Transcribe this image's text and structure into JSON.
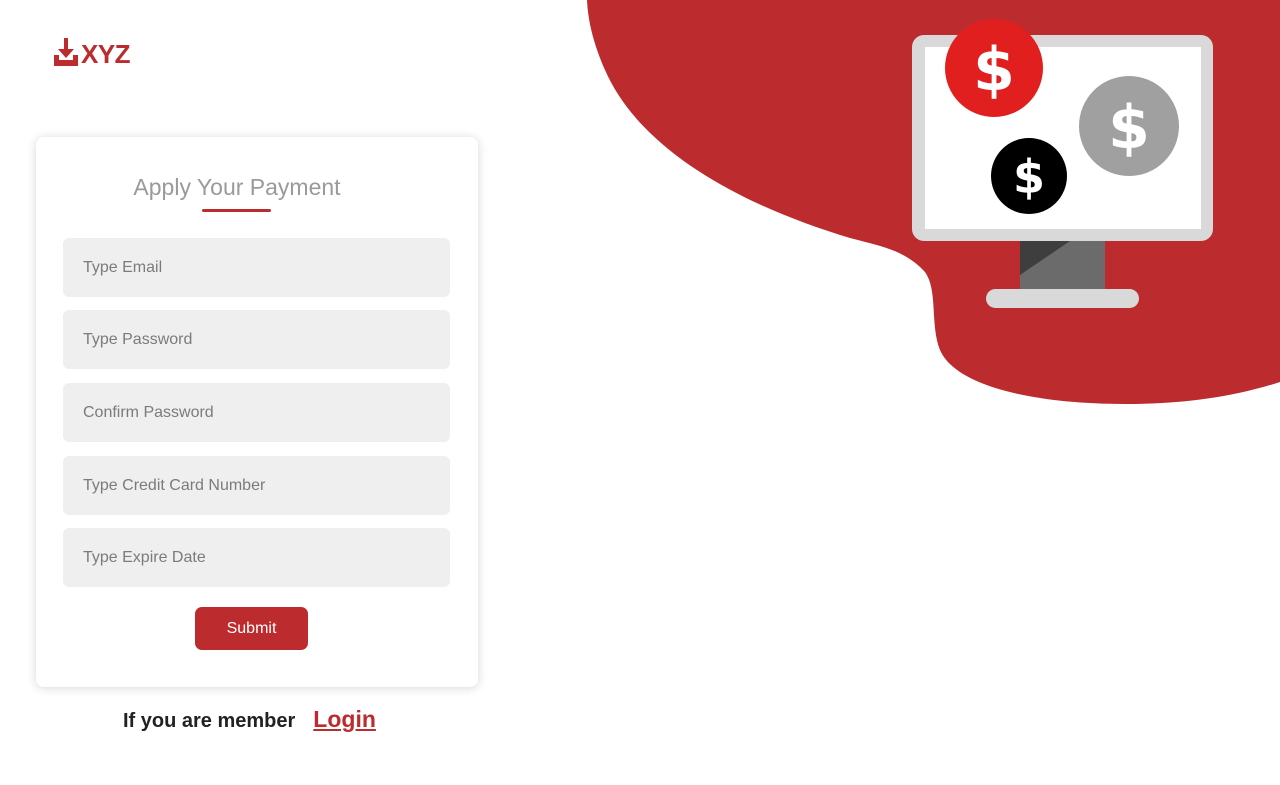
{
  "brand": {
    "name": "XYZ",
    "color": "#bc2b2e",
    "logo_icon": "download-tray-icon"
  },
  "form": {
    "title": "Apply Your Payment",
    "fields": {
      "email_placeholder": "Type Email",
      "password_placeholder": "Type Password",
      "confirm_password_placeholder": "Confirm Password",
      "card_number_placeholder": "Type Credit Card Number",
      "expire_date_placeholder": "Type Expire Date"
    },
    "submit_label": "Submit"
  },
  "footer": {
    "member_text": "If you are member",
    "login_label": "Login"
  },
  "illustration": {
    "blob_color": "#bc2b2e",
    "coins": [
      {
        "symbol": "$",
        "color": "#e11f1f"
      },
      {
        "symbol": "$",
        "color": "#a0a0a0"
      },
      {
        "symbol": "$",
        "color": "#000000"
      }
    ],
    "monitor_icon": "monitor-icon"
  }
}
